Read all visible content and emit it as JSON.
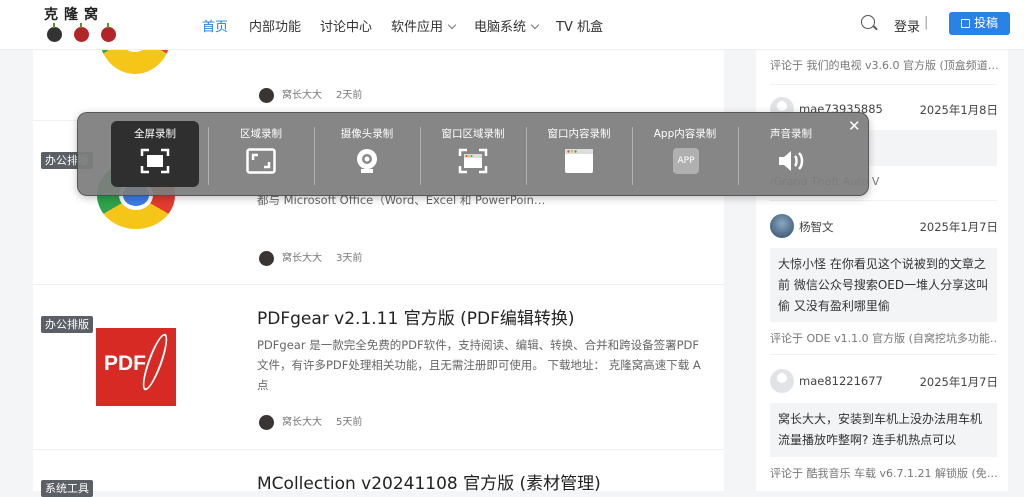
{
  "header": {
    "logo_text": "克隆窝",
    "nav": [
      {
        "label": "首页",
        "active": true
      },
      {
        "label": "内部功能"
      },
      {
        "label": "讨论中心"
      },
      {
        "label": "软件应用",
        "dropdown": true
      },
      {
        "label": "电脑系统",
        "dropdown": true
      },
      {
        "label": "TV 机盒"
      }
    ],
    "login": "登录",
    "login_sep": "|",
    "post_button": "投稿",
    "accent": "#2a82e4"
  },
  "articles": [
    {
      "author": "窝长大大",
      "time": "2天前"
    },
    {
      "category": "办公排版",
      "excerpt_tail": "都与 Microsoft Office（Word、Excel 和 PowerPoin…",
      "author": "窝长大大",
      "time": "3天前"
    },
    {
      "category": "办公排版",
      "title": "PDFgear v2.1.11 官方版 (PDF编辑转换)",
      "excerpt": "PDFgear 是一款完全免费的PDF软件，支持阅读、编辑、转换、合并和跨设备签署PDF文件，有许多PDF处理相关功能，且无需注册即可使用。 下载地址： 克隆窝高速下载 A点",
      "author": "窝长大大",
      "time": "5天前",
      "thumb_text": "PDF"
    },
    {
      "category": "系统工具",
      "title": "MCollection v20241108 官方版 (素材管理)"
    }
  ],
  "sidebar": {
    "comments": [
      {
        "ref": "评论于 我们的电视 v3.6.0 官方版 (顶盒频道…"
      },
      {
        "user": "mae73935885",
        "date": "2025年1月8日",
        "ref": "/Grand Theft Auto V"
      },
      {
        "user": "杨智文",
        "date": "2025年1月7日",
        "text": "大惊小怪 在你看见这个说被到的文章之前 微信公众号搜索OED一堆人分享这叫偷 又没有盈利哪里偷",
        "ref": "评论于 ODE v1.1.0 官方版 (自窝挖坑多功能…"
      },
      {
        "user": "mae81221677",
        "date": "2025年1月7日",
        "text": "窝长大大，安装到车机上没办法用车机流量播放咋整啊? 连手机热点可以",
        "ref": "评论于 酷我音乐 车载 v6.7.1.21 解锁版 (免…"
      }
    ]
  },
  "recorder": {
    "modes": [
      {
        "label": "全屏录制",
        "icon": "fullscreen-record-icon",
        "active": true
      },
      {
        "label": "区域录制",
        "icon": "region-record-icon"
      },
      {
        "label": "摄像头录制",
        "icon": "camera-record-icon"
      },
      {
        "label": "窗口区域录制",
        "icon": "window-region-record-icon"
      },
      {
        "label": "窗口内容录制",
        "icon": "window-content-record-icon"
      },
      {
        "label": "App内容录制",
        "icon": "app-record-icon",
        "icon_text": "APP"
      },
      {
        "label": "声音录制",
        "icon": "audio-record-icon"
      }
    ],
    "close": "✕"
  }
}
